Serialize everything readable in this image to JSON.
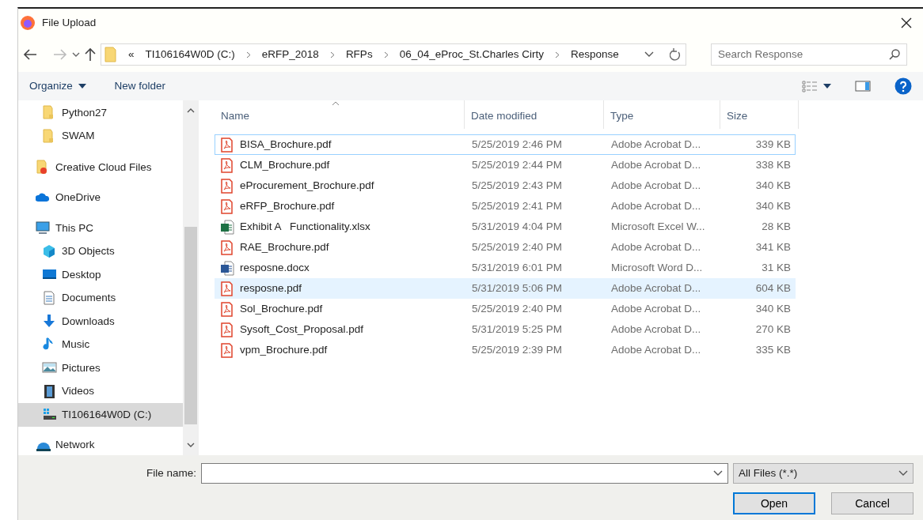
{
  "window": {
    "title": "File Upload"
  },
  "address_bar": {
    "crumbs": [
      "«",
      "TI106164W0D (C:)",
      "eRFP_2018",
      "RFPs",
      "06_04_eProc_St.Charles Cirty",
      "Response"
    ]
  },
  "search": {
    "placeholder": "Search Response"
  },
  "toolbar": {
    "buttons": [
      "Organize",
      "New folder"
    ]
  },
  "sidebar": {
    "continued_children": [
      {
        "label": "Python27",
        "kind": "folder",
        "selected": false
      },
      {
        "label": "SWAM",
        "kind": "folder",
        "selected": false
      }
    ],
    "items": [
      {
        "label": "Creative Cloud Files",
        "kind": "cloudfolder",
        "selected": false
      },
      {
        "label": "OneDrive",
        "kind": "cloud",
        "selected": false
      },
      {
        "label": "This PC",
        "kind": "pc",
        "selected": false,
        "children": [
          {
            "label": "3D Objects",
            "kind": "cube",
            "selected": false
          },
          {
            "label": "Desktop",
            "kind": "desktop",
            "selected": false
          },
          {
            "label": "Documents",
            "kind": "document",
            "selected": false
          },
          {
            "label": "Downloads",
            "kind": "download",
            "selected": false
          },
          {
            "label": "Music",
            "kind": "music",
            "selected": false
          },
          {
            "label": "Pictures",
            "kind": "pictures",
            "selected": false
          },
          {
            "label": "Videos",
            "kind": "video",
            "selected": false
          },
          {
            "label": "TI106164W0D (C:)",
            "kind": "drive",
            "selected": true
          }
        ]
      },
      {
        "label": "Network",
        "kind": "network",
        "selected": false
      }
    ]
  },
  "table": {
    "columns": [
      "Name",
      "Date modified",
      "Type",
      "Size"
    ],
    "rows": [
      {
        "kind": "pdf",
        "name": "BISA_Brochure.pdf",
        "date": "5/25/2019 2:46 PM",
        "type": "Adobe Acrobat D...",
        "size": "339 KB",
        "selected": false,
        "focused": true
      },
      {
        "kind": "pdf",
        "name": "CLM_Brochure.pdf",
        "date": "5/25/2019 2:44 PM",
        "type": "Adobe Acrobat D...",
        "size": "338 KB",
        "selected": false,
        "focused": false
      },
      {
        "kind": "pdf",
        "name": "eProcurement_Brochure.pdf",
        "date": "5/25/2019 2:43 PM",
        "type": "Adobe Acrobat D...",
        "size": "340 KB",
        "selected": false,
        "focused": false
      },
      {
        "kind": "pdf",
        "name": "eRFP_Brochure.pdf",
        "date": "5/25/2019 2:41 PM",
        "type": "Adobe Acrobat D...",
        "size": "340 KB",
        "selected": false,
        "focused": false
      },
      {
        "kind": "excel",
        "name": "Exhibit A   Functionality.xlsx",
        "date": "5/31/2019 4:04 PM",
        "type": "Microsoft Excel W...",
        "size": "28 KB",
        "selected": false,
        "focused": false
      },
      {
        "kind": "pdf",
        "name": "RAE_Brochure.pdf",
        "date": "5/25/2019 2:40 PM",
        "type": "Adobe Acrobat D...",
        "size": "341 KB",
        "selected": false,
        "focused": false
      },
      {
        "kind": "word",
        "name": "resposne.docx",
        "date": "5/31/2019 6:01 PM",
        "type": "Microsoft Word D...",
        "size": "31 KB",
        "selected": false,
        "focused": false
      },
      {
        "kind": "pdf",
        "name": "resposne.pdf",
        "date": "5/31/2019 5:06 PM",
        "type": "Adobe Acrobat D...",
        "size": "604 KB",
        "selected": true,
        "focused": false
      },
      {
        "kind": "pdf",
        "name": "Sol_Brochure.pdf",
        "date": "5/25/2019 2:40 PM",
        "type": "Adobe Acrobat D...",
        "size": "340 KB",
        "selected": false,
        "focused": false
      },
      {
        "kind": "pdf",
        "name": "Sysoft_Cost_Proposal.pdf",
        "date": "5/31/2019 5:25 PM",
        "type": "Adobe Acrobat D...",
        "size": "270 KB",
        "selected": false,
        "focused": false
      },
      {
        "kind": "pdf",
        "name": "vpm_Brochure.pdf",
        "date": "5/25/2019 2:39 PM",
        "type": "Adobe Acrobat D...",
        "size": "335 KB",
        "selected": false,
        "focused": false
      }
    ]
  },
  "footer": {
    "file_name_label": "File name:",
    "file_type": "All Files (*.*)",
    "buttons": [
      {
        "label": "Open",
        "default": true
      },
      {
        "label": "Cancel",
        "default": false
      }
    ]
  }
}
